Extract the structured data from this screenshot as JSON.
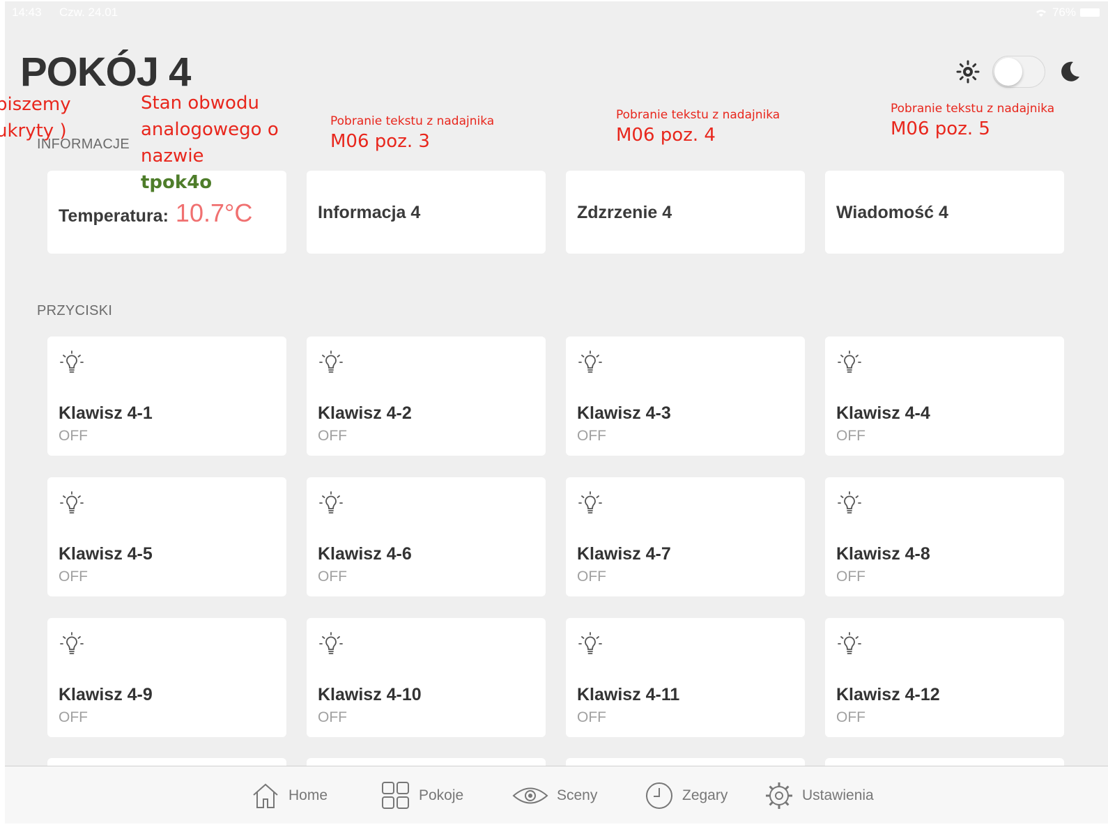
{
  "status_bar": {
    "time": "14:43",
    "date": "Czw. 24.01",
    "battery": "76%"
  },
  "page_title": "POKÓJ 4",
  "sections": {
    "info_label": "INFORMACJE",
    "buttons_label": "PRZYCISKI"
  },
  "info_cards": [
    {
      "label": "Temperatura:",
      "value": "10.7°C"
    },
    {
      "label": "Informacja 4"
    },
    {
      "label": "Zdzrzenie 4"
    },
    {
      "label": "Wiadomość 4"
    }
  ],
  "buttons": [
    {
      "label": "Klawisz 4-1",
      "state": "OFF"
    },
    {
      "label": "Klawisz 4-2",
      "state": "OFF"
    },
    {
      "label": "Klawisz 4-3",
      "state": "OFF"
    },
    {
      "label": "Klawisz 4-4",
      "state": "OFF"
    },
    {
      "label": "Klawisz 4-5",
      "state": "OFF"
    },
    {
      "label": "Klawisz 4-6",
      "state": "OFF"
    },
    {
      "label": "Klawisz 4-7",
      "state": "OFF"
    },
    {
      "label": "Klawisz 4-8",
      "state": "OFF"
    },
    {
      "label": "Klawisz 4-9",
      "state": "OFF"
    },
    {
      "label": "Klawisz 4-10",
      "state": "OFF"
    },
    {
      "label": "Klawisz 4-11",
      "state": "OFF"
    },
    {
      "label": "Klawisz 4-12",
      "state": "OFF"
    }
  ],
  "tabs": [
    {
      "label": "Home",
      "icon": "home-icon"
    },
    {
      "label": "Pokoje",
      "icon": "grid-icon"
    },
    {
      "label": "Sceny",
      "icon": "eye-icon"
    },
    {
      "label": "Zegary",
      "icon": "clock-icon"
    },
    {
      "label": "Ustawienia",
      "icon": "gear-icon"
    }
  ],
  "annotations": {
    "left_line1": "piszemy",
    "left_line2": "ukryty )",
    "circuit_line1": "Stan obwodu",
    "circuit_line2": "analogowego o",
    "circuit_line3": "nazwie",
    "circuit_name": "tpok4o",
    "note_small": "Pobranie tekstu z nadajnika",
    "pos3": "M06 poz. 3",
    "pos4": "M06 poz. 4",
    "pos5": "M06 poz. 5"
  },
  "colors": {
    "accent_temp": "#f07070",
    "annotation_red": "#e8261c",
    "annotation_green": "#4e7d2a",
    "background": "#efefef"
  },
  "theme_toggle": {
    "dark_mode": false
  }
}
